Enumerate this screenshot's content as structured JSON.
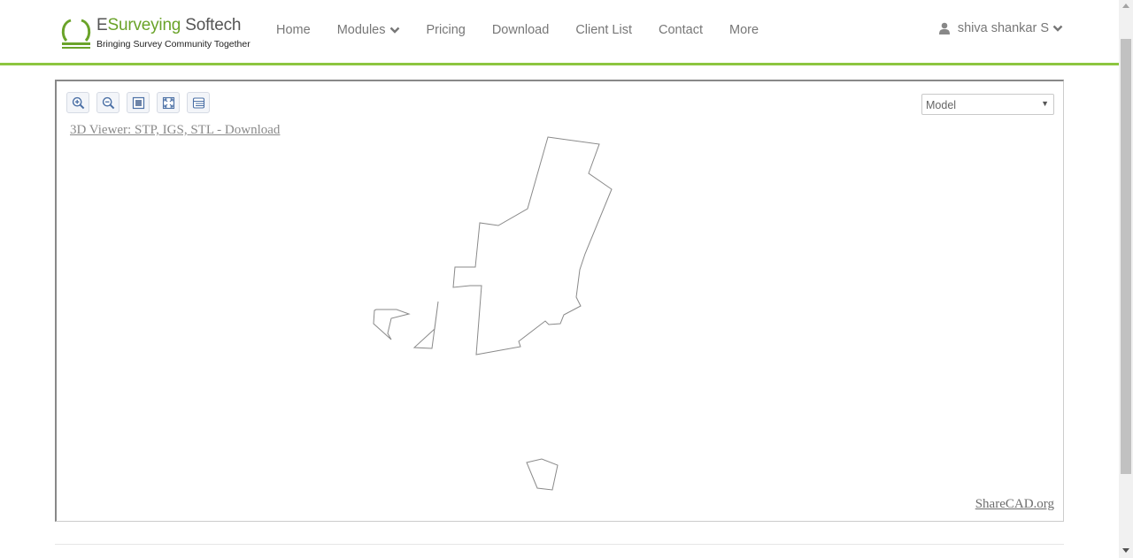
{
  "brand": {
    "name_e": "E",
    "name_surveying": "Surveying",
    "name_softech": " Softech",
    "tagline": "Bringing Survey Community Together",
    "logo_icon": "omega-logo-icon",
    "accent_color": "#8dc63f"
  },
  "nav": {
    "home": "Home",
    "modules": "Modules",
    "pricing": "Pricing",
    "download": "Download",
    "client_list": "Client List",
    "contact": "Contact",
    "more": "More"
  },
  "user": {
    "name": "shiva shankar S",
    "icon": "user-icon"
  },
  "viewer": {
    "toolbar": {
      "zoom_in": "zoom-in-icon",
      "zoom_out": "zoom-out-icon",
      "fit": "fit-window-icon",
      "fullscreen": "fullscreen-icon",
      "layers": "layers-icon"
    },
    "link_text": "3D Viewer: STP, IGS, STL - Download",
    "layout_value": "Model",
    "sharecad_text": "ShareCAD.org"
  }
}
